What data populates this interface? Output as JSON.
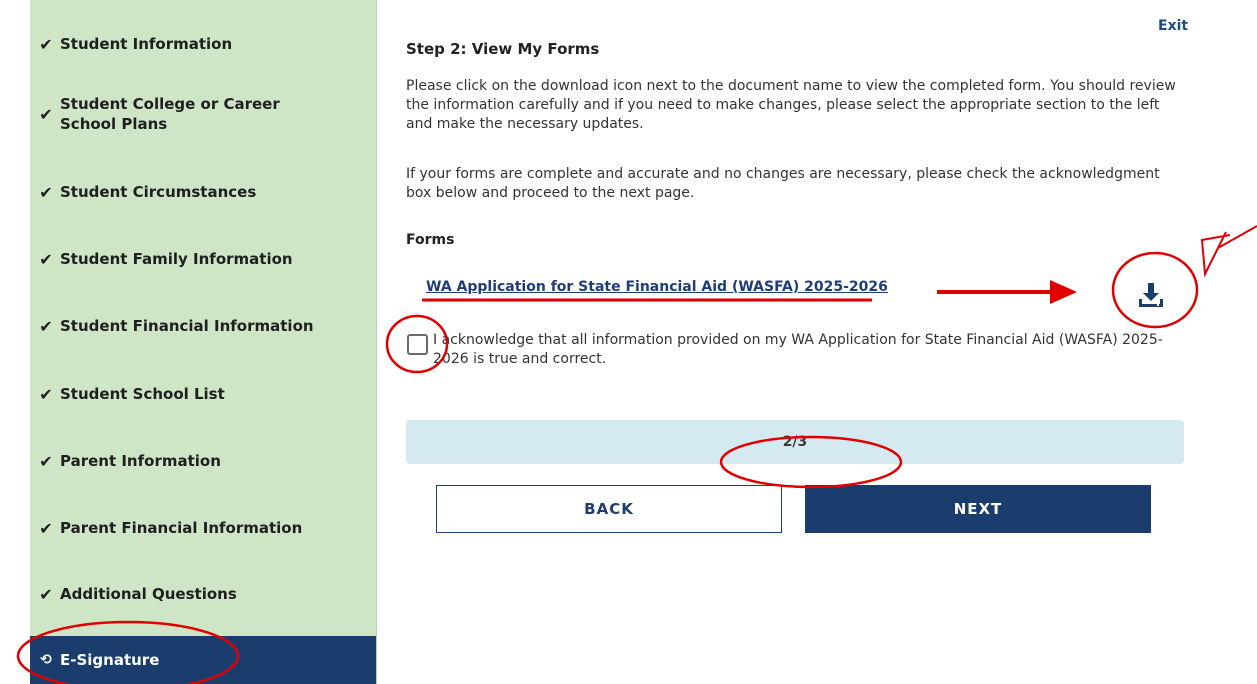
{
  "sidebar": {
    "items": [
      {
        "label": "Student Information",
        "icon": "check-icon"
      },
      {
        "label": "Student College or Career School Plans",
        "icon": "check-icon"
      },
      {
        "label": "Student Circumstances",
        "icon": "check-icon"
      },
      {
        "label": "Student Family Information",
        "icon": "check-icon"
      },
      {
        "label": "Student Financial Information",
        "icon": "check-icon"
      },
      {
        "label": "Student School List",
        "icon": "check-icon"
      },
      {
        "label": "Parent Information",
        "icon": "check-icon"
      },
      {
        "label": "Parent Financial Information",
        "icon": "check-icon"
      },
      {
        "label": "Additional Questions",
        "icon": "check-icon"
      },
      {
        "label": "E-Signature",
        "icon": "history-icon",
        "active": true
      }
    ],
    "check_glyph": "✔",
    "active_glyph": "⟲"
  },
  "header": {
    "exit_label": "Exit"
  },
  "main": {
    "step_title": "Step 2: View My Forms",
    "instructions": "Please click on the download icon next to the document name to view the completed form. You should review the information carefully and if you need to make changes, please select the appropriate section to the left and make the necessary updates.",
    "confirm_text": "If your forms are complete and accurate and no changes are necessary, please check the acknowledgment box below and proceed to the next page.",
    "forms_heading": "Forms",
    "form_link": "WA Application for State Financial Aid (WASFA) 2025-2026",
    "download_icon": "download-icon",
    "acknowledge_text": "I acknowledge that all information provided on my WA Application for State Financial Aid (WASFA) 2025-2026 is true and correct.",
    "acknowledge_checked": false,
    "progress": {
      "text": "2/3",
      "current": 2,
      "total": 3
    },
    "back_label": "BACK",
    "next_label": "NEXT"
  },
  "colors": {
    "sidebar_bg": "#cfe6c6",
    "active_bg": "#1a3d6d",
    "primary": "#1a3d6d",
    "progress_bg": "#d4e9f0",
    "annotation": "#e00000"
  }
}
